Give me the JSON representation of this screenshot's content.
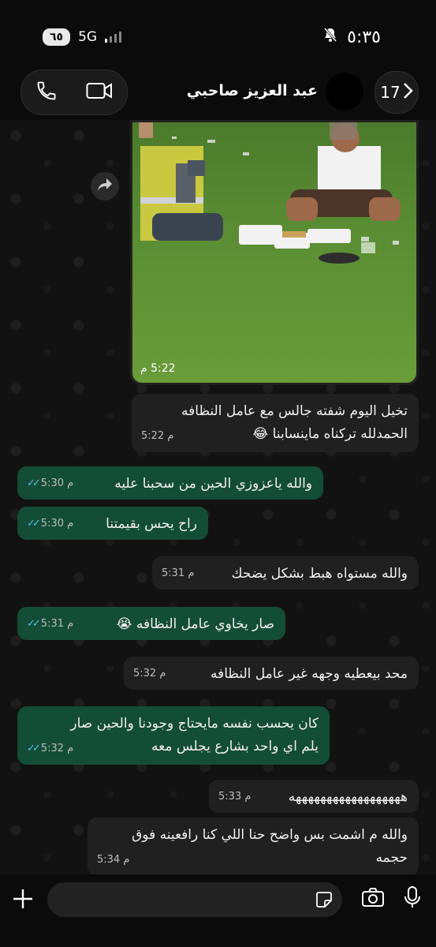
{
  "status_bar": {
    "battery": "٦٥",
    "network": "5G",
    "time": "٥:٣٥"
  },
  "header": {
    "contact_name": "عبد العزيز صاحبي",
    "unread_count": "17"
  },
  "photo_message": {
    "time": "5:22 م"
  },
  "messages": [
    {
      "direction": "in",
      "lines": [
        "تخيل اليوم شفته جالس مع  عامل النظافه",
        "الحمدلله تركناه ماينسابنا 😂"
      ],
      "time": "5:22 م"
    },
    {
      "direction": "out",
      "lines": [
        "والله ياعزوزي الحين من سحبنا عليه"
      ],
      "time": "5:30 م"
    },
    {
      "direction": "out",
      "lines": [
        "راح يحس بقيمتنا"
      ],
      "time": "5:30 م"
    },
    {
      "direction": "in",
      "lines": [
        "والله مستواه هبط بشكل يضحك"
      ],
      "time": "5:31 م"
    },
    {
      "direction": "out",
      "lines": [
        "صار يخاوي عامل النظافه 😭"
      ],
      "time": "5:31 م"
    },
    {
      "direction": "in",
      "lines": [
        "محد بيعطيه وجهه غير عامل النظافه"
      ],
      "time": "5:32 م"
    },
    {
      "direction": "out",
      "lines": [
        "كان يحسب نفسه مايحتاج وجودنا والحين صار",
        "يلم اي واحد بشارع يجلس معه"
      ],
      "time": "5:32 م"
    },
    {
      "direction": "in",
      "lines": [
        "ههههههههههههههههههه"
      ],
      "time": "5:33 م"
    },
    {
      "direction": "in",
      "lines": [
        "والله م اشمت بس واضح حنا اللي كنا رافعينه فوق",
        "حجمه"
      ],
      "time": "5:34 م"
    }
  ],
  "composer": {
    "placeholder": ""
  }
}
